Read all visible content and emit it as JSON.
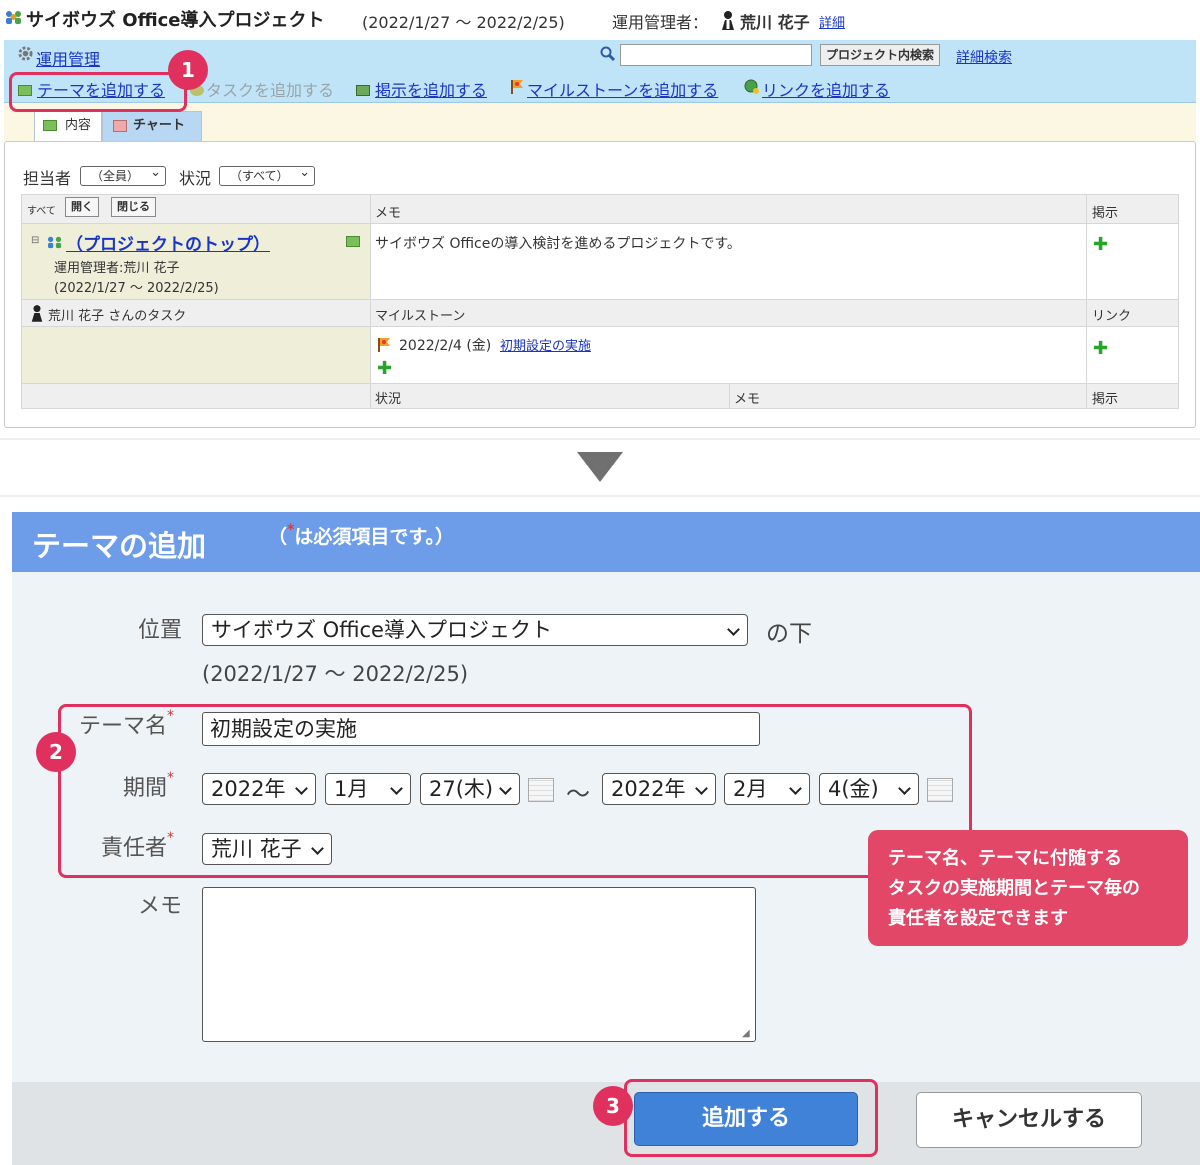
{
  "header": {
    "project_title": "サイボウズ Office導入プロジェクト",
    "project_dates": "(2022/1/27 〜 2022/2/25)",
    "admin_label": "運用管理者：",
    "admin_name": "荒川 花子",
    "detail_link": "詳細"
  },
  "toolbar": {
    "admin_link": "運用管理",
    "search_placeholder": "",
    "search_button": "プロジェクト内検索",
    "advanced_search": "詳細検索",
    "add_theme": "テーマを追加する",
    "add_task": "タスクを追加する",
    "add_board": "掲示を追加する",
    "add_milestone": "マイルストーンを追加する",
    "add_link": "リンクを追加する"
  },
  "tabs": [
    {
      "label": "内容",
      "active": true
    },
    {
      "label": "チャート",
      "active": false
    }
  ],
  "filters": {
    "assignee_label": "担当者",
    "assignee_value": "（全員）",
    "status_label": "状況",
    "status_value": "（すべて）"
  },
  "grid": {
    "all_label": "すべて",
    "open_button": "開く",
    "close_button": "閉じる",
    "memo_header": "メモ",
    "board_header": "掲示",
    "project_top_link": "（プロジェクトのトップ）",
    "admin_line": "運用管理者:荒川 花子",
    "dates_line": "(2022/1/27 〜 2022/2/25)",
    "project_memo": "サイボウズ Officeの導入検討を進めるプロジェクトです。",
    "task_owner": "荒川 花子 さんのタスク",
    "milestone_header": "マイルストーン",
    "link_header": "リンク",
    "milestone_date": "2022/2/4 (金)",
    "milestone_link": "初期設定の実施",
    "status_header": "状況",
    "memo_header2": "メモ",
    "board_header2": "掲示"
  },
  "form": {
    "title": "テーマの追加",
    "required_note_pre": "（",
    "required_star": "*",
    "required_note": "は必須項目です。）",
    "position_label": "位置",
    "position_value": "サイボウズ Office導入プロジェクト",
    "position_suffix": "の下",
    "position_dates": "(2022/1/27 〜 2022/2/25)",
    "theme_name_label": "テーマ名",
    "theme_name_value": "初期設定の実施",
    "period_label": "期間",
    "start_year": "2022年",
    "start_month": "1月",
    "start_day": "27(木)",
    "range_sep": "〜",
    "end_year": "2022年",
    "end_month": "2月",
    "end_day": "4(金)",
    "owner_label": "責任者",
    "owner_value": "荒川 花子",
    "memo_label": "メモ",
    "memo_value": "",
    "submit_button": "追加する",
    "cancel_button": "キャンセルする"
  },
  "annotations": {
    "step1": "1",
    "step2": "2",
    "step3": "3",
    "callout_line1": "テーマ名、テーマに付随する",
    "callout_line2": "タスクの実施期間とテーマ毎の",
    "callout_line3": "責任者を設定できます"
  },
  "colors": {
    "accent_red": "#e0305e",
    "form_header_blue": "#6d9de8",
    "toolbar_blue": "#bfe4f8",
    "submit_blue": "#3f82d8"
  }
}
